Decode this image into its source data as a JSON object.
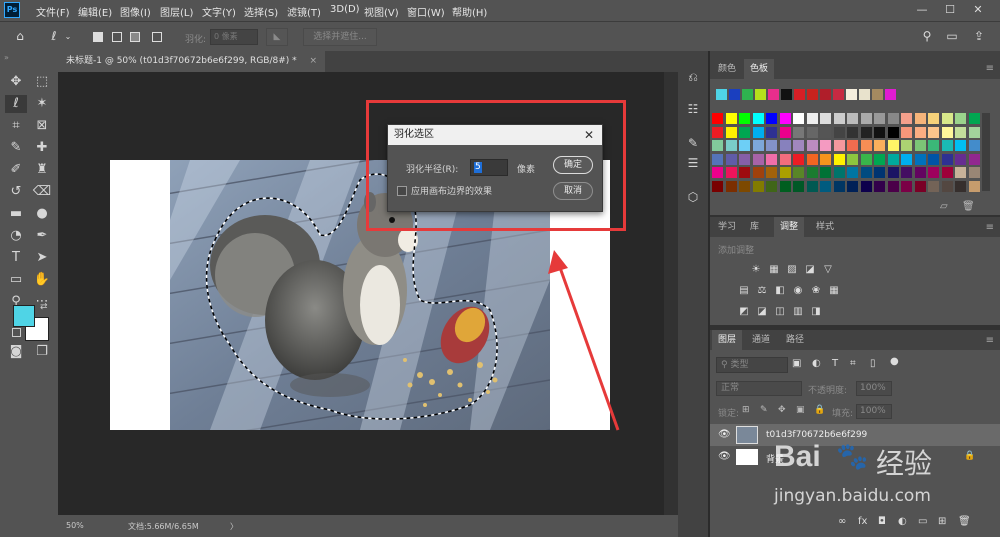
{
  "app": {
    "logo": "Ps"
  },
  "menu": {
    "items": [
      "文件(F)",
      "编辑(E)",
      "图像(I)",
      "图层(L)",
      "文字(Y)",
      "选择(S)",
      "滤镜(T)",
      "3D(D)",
      "视图(V)",
      "窗口(W)",
      "帮助(H)"
    ]
  },
  "window_controls": {
    "minimize": "—",
    "maximize": "☐",
    "close": "✕"
  },
  "options": {
    "feather_label": "羽化:",
    "feather_value": "0 像素",
    "select_mask_label": "选择并遮住..."
  },
  "document": {
    "tab_title": "未标题-1 @ 50% (t01d3f70672b6e6f299, RGB/8#) *",
    "tab_close": "×"
  },
  "status": {
    "zoom": "50%",
    "doc_info": "文档:5.66M/6.65M",
    "arrow": "〉"
  },
  "swatch_panel": {
    "tabs": [
      "颜色",
      "色板"
    ],
    "active_tab": "色板",
    "recent_colors": [
      "#4fd4e6",
      "#1a3fbf",
      "#2fb34f",
      "#b6e01c",
      "#e82e8c",
      "#111111",
      "#d81f26",
      "#c8231e",
      "#b01e2a",
      "#c72a42",
      "#f5eedd",
      "#e8e2cc",
      "#a48a60",
      "#e01cd0"
    ],
    "grid_colors": [
      [
        "#ff0000",
        "#ffff00",
        "#00ff00",
        "#00ffff",
        "#0000ff",
        "#ff00ff",
        "#ffffff",
        "#eeeeee",
        "#dddddd",
        "#cccccc",
        "#bbbbbb",
        "#aaaaaa",
        "#999999",
        "#888888",
        "#f4a08c",
        "#f6b47a",
        "#f7d27a",
        "#d8e88a",
        "#9bd38c",
        "#00a651"
      ],
      [
        "#ed1c24",
        "#fff200",
        "#00a651",
        "#00aeef",
        "#2e3192",
        "#ec008c",
        "#777777",
        "#666666",
        "#555555",
        "#444444",
        "#333333",
        "#222222",
        "#111111",
        "#000000",
        "#f7977a",
        "#fbad82",
        "#fdc68c",
        "#fff79a",
        "#c4df9b",
        "#a2d39c"
      ],
      [
        "#82ca9c",
        "#7accc8",
        "#6dcff6",
        "#7da7d9",
        "#8393ca",
        "#8781bd",
        "#a187be",
        "#bc8cbf",
        "#f49ac1",
        "#f5989d",
        "#f26c4f",
        "#f68e55",
        "#fbaf5c",
        "#fff467",
        "#acd372",
        "#7cc576",
        "#3bb878",
        "#1abbb4",
        "#00bff3",
        "#438ccb"
      ],
      [
        "#5574b9",
        "#605ca8",
        "#855fa8",
        "#a763a8",
        "#f06ea9",
        "#f26d7d",
        "#ed1c24",
        "#f26522",
        "#f7941d",
        "#fff200",
        "#8dc63f",
        "#39b54a",
        "#00a651",
        "#00a99d",
        "#00aeef",
        "#0072bc",
        "#0054a6",
        "#2e3192",
        "#662d91",
        "#92278f"
      ],
      [
        "#ec008c",
        "#ed145b",
        "#9e0b0f",
        "#a0410d",
        "#a36209",
        "#aba000",
        "#598527",
        "#1a7b30",
        "#007236",
        "#00746b",
        "#0076a3",
        "#004b80",
        "#003471",
        "#1b1464",
        "#440e62",
        "#630460",
        "#9e005d",
        "#9e0039",
        "#c7b299",
        "#998675"
      ],
      [
        "#790000",
        "#7b2e00",
        "#7d4900",
        "#827b00",
        "#406618",
        "#005e20",
        "#005826",
        "#005952",
        "#005b7f",
        "#003663",
        "#002157",
        "#0d004c",
        "#32004b",
        "#4b0049",
        "#7b0046",
        "#7a0026",
        "#736357",
        "#534741",
        "#362f2d",
        "#c69c6d"
      ]
    ]
  },
  "adjust_panel": {
    "tabs": [
      "学习",
      "库",
      "调整",
      "样式"
    ],
    "active_tab": "调整",
    "hint": "添加调整",
    "row1": [
      "☀",
      "▦",
      "▨",
      "◪",
      "▽"
    ],
    "row2": [
      "▤",
      "⚖",
      "◧",
      "◉",
      "❀",
      "▦"
    ],
    "row3": [
      "◩",
      "◪",
      "◫",
      "▥",
      "◨"
    ]
  },
  "layers_panel": {
    "tabs": [
      "图层",
      "通道",
      "路径"
    ],
    "active_tab": "图层",
    "search_placeholder": "类型",
    "blend_mode": "正常",
    "opacity_label": "不透明度:",
    "opacity_value": "100%",
    "lock_label": "锁定:",
    "fill_label": "填充:",
    "fill_value": "100%",
    "layers": [
      {
        "name": "t01d3f70672b6e6f299",
        "visible": true,
        "selected": true
      },
      {
        "name": "背景",
        "visible": true,
        "selected": false,
        "locked": true
      }
    ],
    "bottom_icons": [
      "∞",
      "fx",
      "◘",
      "◐",
      "▭",
      "⊞",
      "🗑"
    ]
  },
  "dialog": {
    "title": "羽化选区",
    "radius_label": "羽化半径(R):",
    "radius_value": "5",
    "unit": "像素",
    "ok": "确定",
    "cancel": "取消",
    "checkbox_label": "应用画布边界的效果",
    "checkbox_checked": false
  },
  "watermark": {
    "brand": "Bai",
    "brand2": "经验",
    "url": "jingyan.baidu.com"
  },
  "colors": {
    "accent_red": "#e63a3a",
    "fg_color": "#4fd4e6",
    "bg_color": "#ffffff"
  }
}
